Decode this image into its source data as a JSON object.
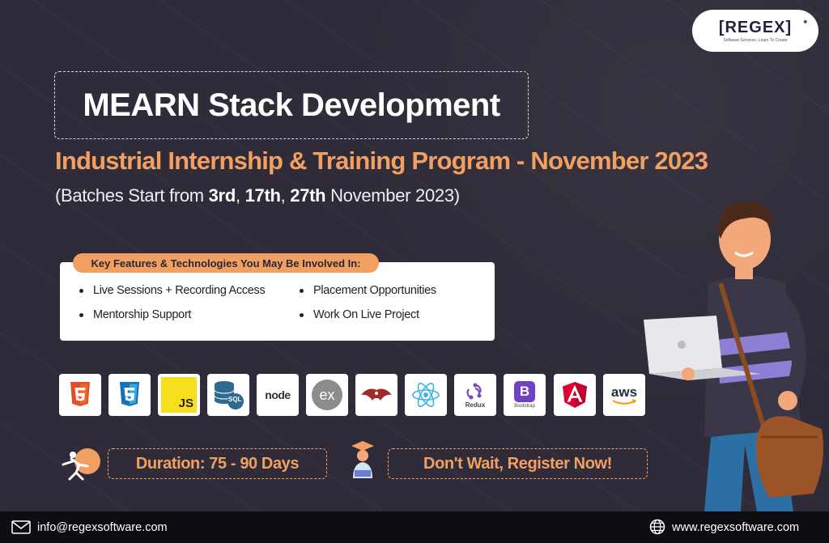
{
  "logo": {
    "name": "[REGEX]",
    "tagline": "Software Services- Learn To Create"
  },
  "header": {
    "title": "MEARN Stack Development",
    "subtitle": "Industrial Internship & Training Program - November 2023",
    "batches_prefix": "(Batches Start from ",
    "batch_1": "3rd",
    "sep_1": ", ",
    "batch_2": "17th",
    "sep_2": ", ",
    "batch_3": "27th",
    "batches_suffix": " November 2023)"
  },
  "features": {
    "heading": "Key Features & Technologies You May Be Involved In:",
    "items": [
      "Live Sessions + Recording Access",
      "Placement Opportunities",
      "Mentorship  Support",
      "Work On Live Project"
    ]
  },
  "tech_stack": {
    "icons": [
      "html5-icon",
      "css3-icon",
      "javascript-icon",
      "sql-icon",
      "nodejs-icon",
      "express-icon",
      "mongoose-icon",
      "react-icon",
      "redux-icon",
      "bootstrap-icon",
      "angular-icon",
      "aws-icon"
    ],
    "labels": {
      "js": "JS",
      "sql": "SQL",
      "node": "node",
      "express": "ex",
      "redux": "Redux",
      "bootstrap_letter": "B",
      "bootstrap": "Bootstrap",
      "aws": "aws"
    }
  },
  "cta": {
    "duration": "Duration: 75 - 90 Days",
    "register": "Don't Wait, Register Now!"
  },
  "footer": {
    "email": "info@regexsoftware.com",
    "website": "www.regexsoftware.com"
  },
  "colors": {
    "background": "#2f2b38",
    "accent": "#f2a062",
    "footer": "#0d0d12"
  }
}
